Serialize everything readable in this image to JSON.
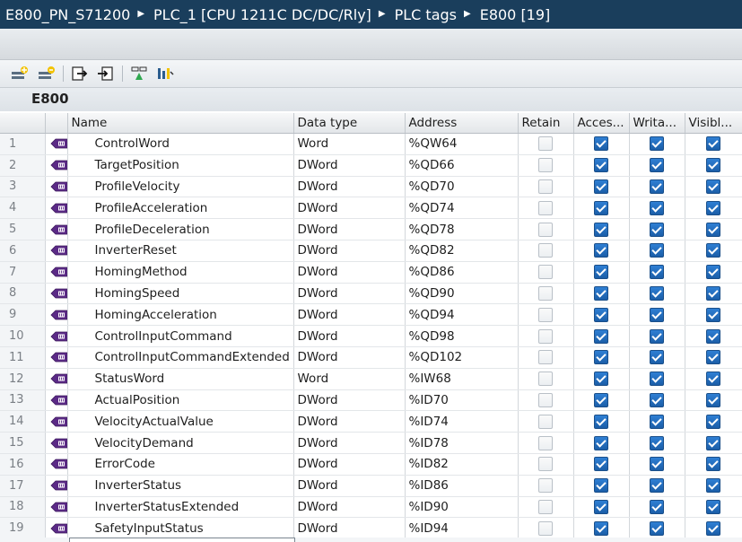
{
  "breadcrumb": [
    "E800_PN_S71200",
    "PLC_1 [CPU 1211C DC/DC/Rly]",
    "PLC tags",
    "E800 [19]"
  ],
  "toolbar": {
    "icons": [
      "add-tag-icon",
      "insert-row-icon",
      "export-icon",
      "import-icon",
      "monitor-icon",
      "show-all-icon"
    ]
  },
  "table_name": "E800",
  "columns": {
    "name": "Name",
    "data_type": "Data type",
    "address": "Address",
    "retain": "Retain",
    "accessible": "Acces...",
    "writable": "Writa...",
    "visible": "Visibl..."
  },
  "rows": [
    {
      "num": "1",
      "name": "ControlWord",
      "type": "Word",
      "address": "%QW64",
      "retain": false,
      "accessible": true,
      "writable": true,
      "visible": true
    },
    {
      "num": "2",
      "name": "TargetPosition",
      "type": "DWord",
      "address": "%QD66",
      "retain": false,
      "accessible": true,
      "writable": true,
      "visible": true
    },
    {
      "num": "3",
      "name": "ProfileVelocity",
      "type": "DWord",
      "address": "%QD70",
      "retain": false,
      "accessible": true,
      "writable": true,
      "visible": true
    },
    {
      "num": "4",
      "name": "ProfileAcceleration",
      "type": "DWord",
      "address": "%QD74",
      "retain": false,
      "accessible": true,
      "writable": true,
      "visible": true
    },
    {
      "num": "5",
      "name": "ProfileDeceleration",
      "type": "DWord",
      "address": "%QD78",
      "retain": false,
      "accessible": true,
      "writable": true,
      "visible": true
    },
    {
      "num": "6",
      "name": "InverterReset",
      "type": "DWord",
      "address": "%QD82",
      "retain": false,
      "accessible": true,
      "writable": true,
      "visible": true
    },
    {
      "num": "7",
      "name": "HomingMethod",
      "type": "DWord",
      "address": "%QD86",
      "retain": false,
      "accessible": true,
      "writable": true,
      "visible": true
    },
    {
      "num": "8",
      "name": "HomingSpeed",
      "type": "DWord",
      "address": "%QD90",
      "retain": false,
      "accessible": true,
      "writable": true,
      "visible": true
    },
    {
      "num": "9",
      "name": "HomingAcceleration",
      "type": "DWord",
      "address": "%QD94",
      "retain": false,
      "accessible": true,
      "writable": true,
      "visible": true
    },
    {
      "num": "10",
      "name": "ControlInputCommand",
      "type": "DWord",
      "address": "%QD98",
      "retain": false,
      "accessible": true,
      "writable": true,
      "visible": true
    },
    {
      "num": "11",
      "name": "ControlInputCommandExtended",
      "type": "DWord",
      "address": "%QD102",
      "retain": false,
      "accessible": true,
      "writable": true,
      "visible": true
    },
    {
      "num": "12",
      "name": "StatusWord",
      "type": "Word",
      "address": "%IW68",
      "retain": false,
      "accessible": true,
      "writable": true,
      "visible": true
    },
    {
      "num": "13",
      "name": "ActualPosition",
      "type": "DWord",
      "address": "%ID70",
      "retain": false,
      "accessible": true,
      "writable": true,
      "visible": true
    },
    {
      "num": "14",
      "name": "VelocityActualValue",
      "type": "DWord",
      "address": "%ID74",
      "retain": false,
      "accessible": true,
      "writable": true,
      "visible": true
    },
    {
      "num": "15",
      "name": "VelocityDemand",
      "type": "DWord",
      "address": "%ID78",
      "retain": false,
      "accessible": true,
      "writable": true,
      "visible": true
    },
    {
      "num": "16",
      "name": "ErrorCode",
      "type": "DWord",
      "address": "%ID82",
      "retain": false,
      "accessible": true,
      "writable": true,
      "visible": true
    },
    {
      "num": "17",
      "name": "InverterStatus",
      "type": "DWord",
      "address": "%ID86",
      "retain": false,
      "accessible": true,
      "writable": true,
      "visible": true
    },
    {
      "num": "18",
      "name": "InverterStatusExtended",
      "type": "DWord",
      "address": "%ID90",
      "retain": false,
      "accessible": true,
      "writable": true,
      "visible": true
    },
    {
      "num": "19",
      "name": "SafetyInputStatus",
      "type": "DWord",
      "address": "%ID94",
      "retain": false,
      "accessible": true,
      "writable": true,
      "visible": true
    }
  ]
}
